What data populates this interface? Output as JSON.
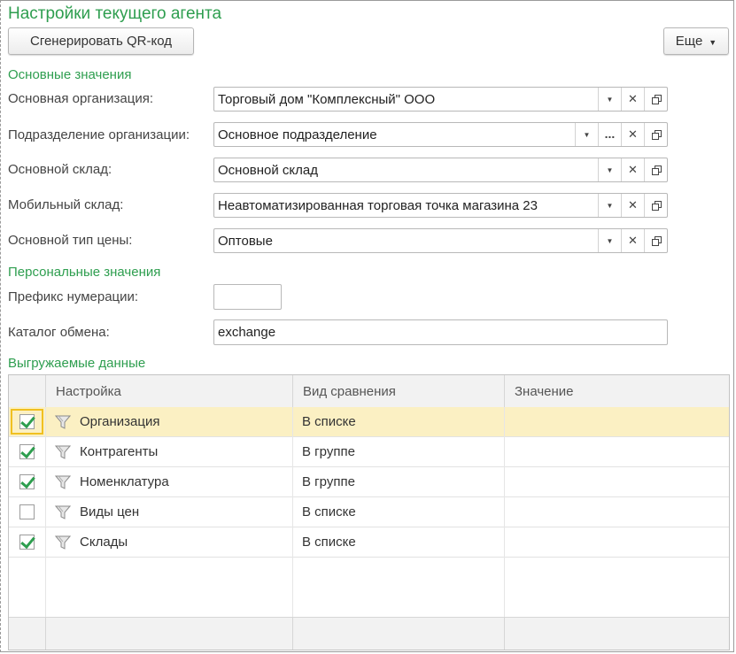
{
  "window": {
    "title": "Настройки текущего агента"
  },
  "toolbar": {
    "qr_button": "Сгенерировать QR-код",
    "more_button": "Еще",
    "more_arrow": "▼"
  },
  "sections": {
    "main": "Основные значения",
    "personal": "Персональные значения",
    "exported": "Выгружаемые данные"
  },
  "fields": {
    "organization": {
      "label": "Основная организация:",
      "value": "Торговый дом \"Комплексный\" ООО"
    },
    "subdivision": {
      "label": "Подразделение организации:",
      "value": "Основное подразделение"
    },
    "warehouse": {
      "label": "Основной склад:",
      "value": "Основной склад"
    },
    "mobile_warehouse": {
      "label": "Мобильный склад:",
      "value": "Неавтоматизированная торговая точка магазина 23"
    },
    "price_type": {
      "label": "Основной тип цены:",
      "value": "Оптовые"
    },
    "prefix": {
      "label": "Префикс нумерации:",
      "value": ""
    },
    "exchange_catalog": {
      "label": "Каталог обмена:",
      "value": "exchange"
    }
  },
  "field_buttons": {
    "dropdown": "▼",
    "clear": "✕",
    "select": "..."
  },
  "table": {
    "columns": [
      "Настройка",
      "Вид сравнения",
      "Значение"
    ],
    "rows": [
      {
        "checked": true,
        "setting": "Организация",
        "comparison": "В списке",
        "value": "",
        "selected": true
      },
      {
        "checked": true,
        "setting": "Контрагенты",
        "comparison": "В группе",
        "value": ""
      },
      {
        "checked": true,
        "setting": "Номенклатура",
        "comparison": "В группе",
        "value": ""
      },
      {
        "checked": false,
        "setting": "Виды цен",
        "comparison": "В списке",
        "value": ""
      },
      {
        "checked": true,
        "setting": "Склады",
        "comparison": "В списке",
        "value": ""
      }
    ]
  },
  "colors": {
    "accent_green": "#2e9e4f",
    "selected_row": "#fbf0c3",
    "focus_border": "#f0c020"
  }
}
